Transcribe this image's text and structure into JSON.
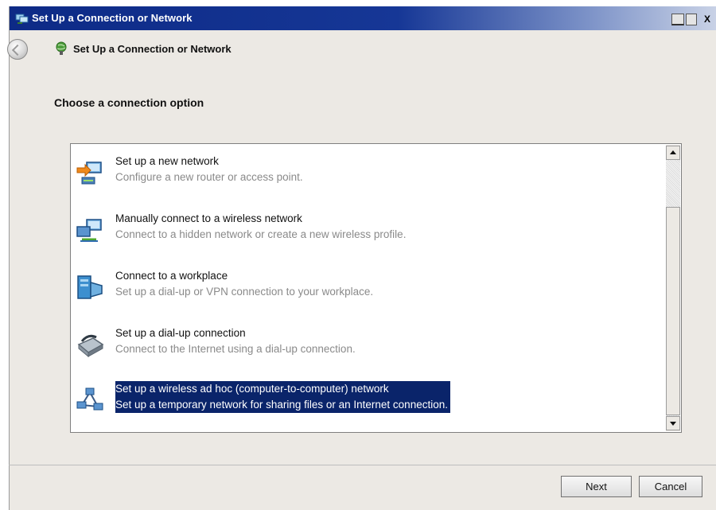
{
  "window": {
    "title": "Set Up a Connection or Network",
    "controls": {
      "minimize": "_",
      "maximize": "□",
      "close": "X"
    }
  },
  "nav": {
    "title": "Set Up a Connection or Network"
  },
  "heading": "Choose a connection option",
  "options": [
    {
      "title": "Set up a new network",
      "desc": "Configure a new router or access point.",
      "icon": "network-wizard-icon"
    },
    {
      "title": "Manually connect to a wireless network",
      "desc": "Connect to a hidden network or create a new wireless profile.",
      "icon": "wireless-network-icon"
    },
    {
      "title": "Connect to a workplace",
      "desc": "Set up a dial-up or VPN connection to your workplace.",
      "icon": "workplace-icon"
    },
    {
      "title": "Set up a dial-up connection",
      "desc": "Connect to the Internet using a dial-up connection.",
      "icon": "dialup-modem-icon"
    },
    {
      "title": "Set up a wireless ad hoc (computer-to-computer) network",
      "desc": "Set up a temporary network for sharing files or an Internet connection.",
      "icon": "adhoc-network-icon",
      "selected": true
    }
  ],
  "buttons": {
    "next": "Next",
    "cancel": "Cancel"
  },
  "colors": {
    "title_bar": "#0d2a86",
    "selection": "#0a246a",
    "window_bg": "#ece9e4"
  }
}
